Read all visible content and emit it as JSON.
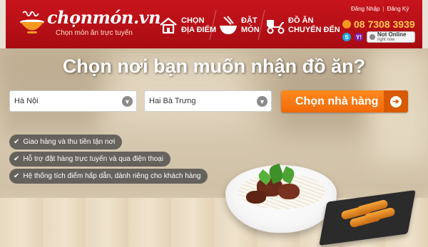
{
  "brand": {
    "name": "chọnmón.vn",
    "tagline": "Chọn món ăn trực tuyến"
  },
  "nav": [
    {
      "line1": "CHỌN",
      "line2": "ĐỊA ĐIỂM",
      "icon": "house-icon"
    },
    {
      "line1": "ĐẶT",
      "line2": "MÓN",
      "icon": "bowl-chopsticks-icon"
    },
    {
      "line1": "ĐỒ ĂN",
      "line2": "CHUYỂN ĐẾN",
      "icon": "delivery-scooter-icon"
    }
  ],
  "auth": {
    "login": "Đăng Nhập",
    "separator": "|",
    "register": "Đăng Ký"
  },
  "hotline": "08 7308 3939",
  "chat_status": {
    "line1": "Not Online",
    "line2": "right now"
  },
  "hero": {
    "headline": "Chọn nơi bạn muốn nhận đồ ăn?",
    "city_select": "Hà Nội",
    "district_select": "Hai Bà Trưng",
    "cta_label": "Chọn nhà hàng",
    "features": [
      "Giao hàng và thu tiền tận nơi",
      "Hỗ trợ đặt hàng trực tuyến và qua điện thoại",
      "Hệ thống tích điểm hấp dẫn, dành riêng cho khách hàng"
    ]
  },
  "colors": {
    "header_red": "#c8141c",
    "cta_orange": "#f47b16",
    "hotline_yellow": "#ffc94a"
  }
}
